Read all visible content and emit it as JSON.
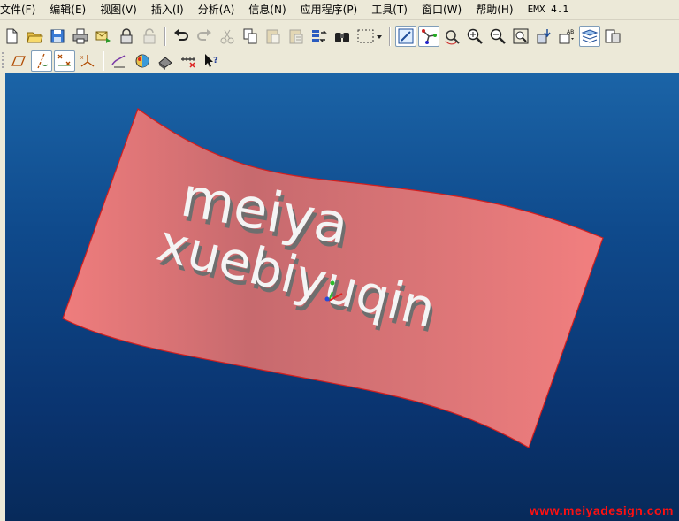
{
  "menu": [
    "文件(F)",
    "编辑(E)",
    "视图(V)",
    "插入(I)",
    "分析(A)",
    "信息(N)",
    "应用程序(P)",
    "工具(T)",
    "窗口(W)",
    "帮助(H)",
    "EMX 4.1"
  ],
  "toolbar1": [
    {
      "icon": "new-file-icon"
    },
    {
      "icon": "open-folder-icon"
    },
    {
      "icon": "save-icon"
    },
    {
      "icon": "print-icon"
    },
    {
      "icon": "send-mail-icon"
    },
    {
      "icon": "lock-icon"
    },
    {
      "icon": "unlock-icon"
    },
    {
      "icon": "undo-icon"
    },
    {
      "icon": "redo-icon"
    },
    {
      "icon": "cut-icon"
    },
    {
      "icon": "copy-icon"
    },
    {
      "icon": "paste-icon"
    },
    {
      "icon": "paste-special-icon"
    },
    {
      "icon": "regenerate-icon"
    },
    {
      "icon": "find-icon"
    },
    {
      "icon": "select-box-dropdown-icon"
    },
    {
      "icon": "repaint-icon"
    },
    {
      "icon": "spin-center-icon"
    },
    {
      "icon": "orient-icon"
    },
    {
      "icon": "zoom-in-icon"
    },
    {
      "icon": "zoom-out-icon"
    },
    {
      "icon": "refit-icon"
    },
    {
      "icon": "reorient-icon"
    },
    {
      "icon": "saved-views-icon"
    },
    {
      "icon": "layers-icon"
    },
    {
      "icon": "view-manager-icon"
    }
  ],
  "toolbar2": [
    {
      "icon": "datum-plane-display-icon"
    },
    {
      "icon": "datum-axis-display-icon"
    },
    {
      "icon": "datum-point-display-icon"
    },
    {
      "icon": "coordinate-system-display-icon"
    },
    {
      "icon": "sketch-icon"
    },
    {
      "icon": "appearance-icon"
    },
    {
      "icon": "model-display-icon"
    },
    {
      "icon": "measure-icon"
    },
    {
      "icon": "whats-this-icon"
    }
  ],
  "model": {
    "line1": "meiya",
    "line2": "xuebiyuqin"
  },
  "watermark": "www.meiyadesign.com"
}
